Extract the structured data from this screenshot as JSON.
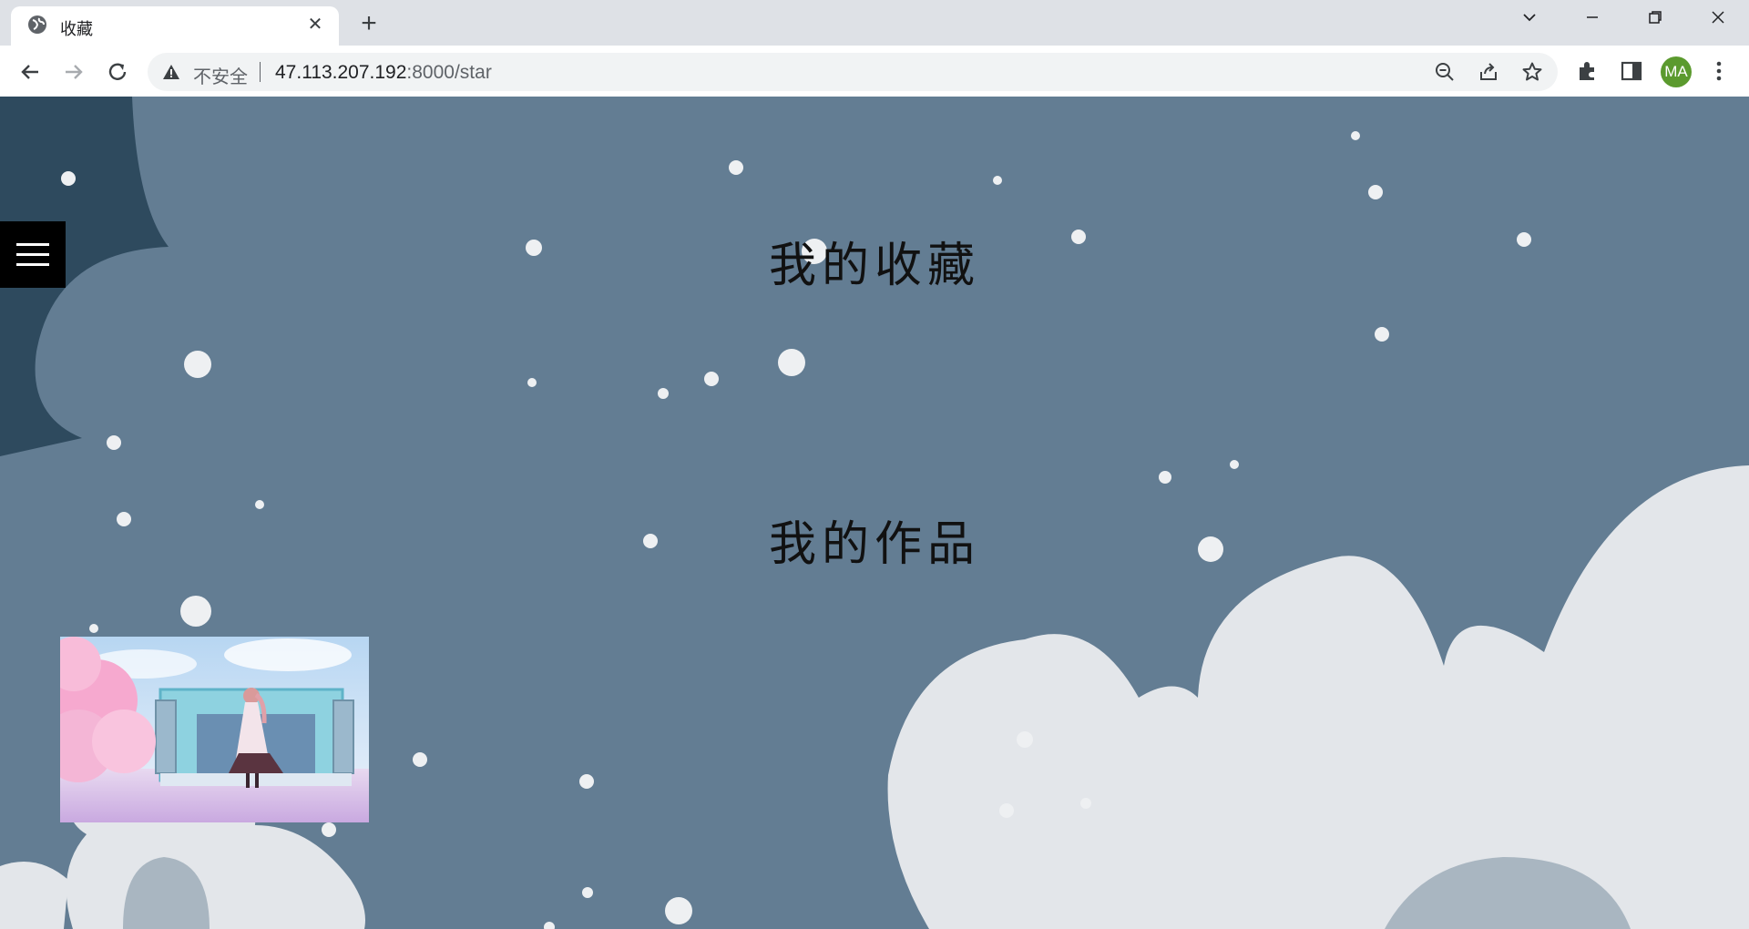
{
  "browser": {
    "tab_title": "收藏",
    "security_label": "不安全",
    "url_host": "47.113.207.192",
    "url_path": ":8000/star",
    "profile_initials": "MA"
  },
  "page": {
    "heading_favorites": "我的收藏",
    "heading_works": "我的作品",
    "artwork_alt": "anime girl on stage with cherry blossoms"
  },
  "colors": {
    "background": "#637d93",
    "cloud": "#e3e6ea",
    "dark_cloud": "#2e4a5e",
    "menu_button": "#000000",
    "avatar": "#5b9a2e"
  }
}
